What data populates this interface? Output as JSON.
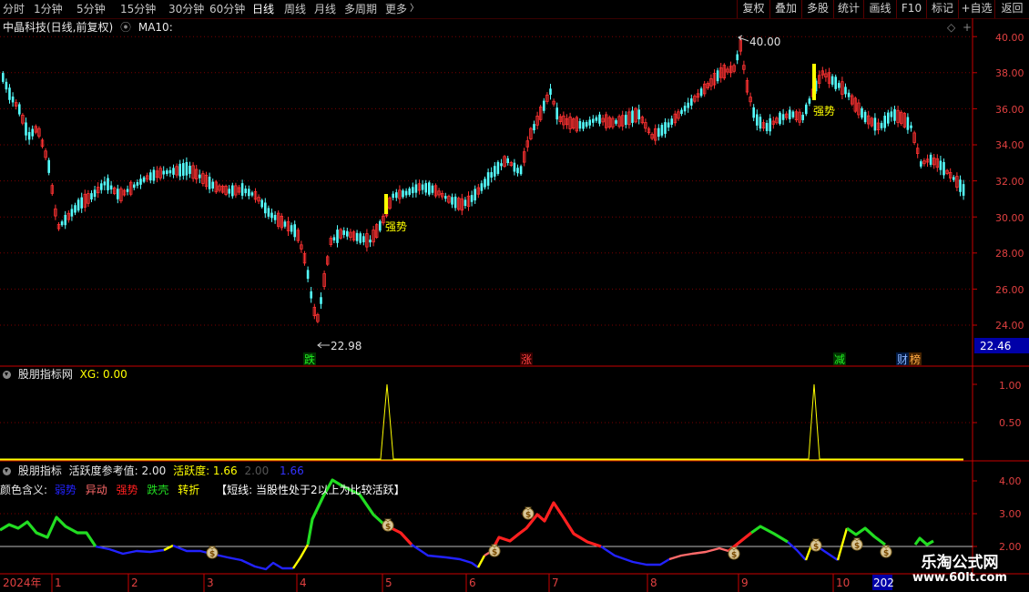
{
  "toolbar": {
    "periods": [
      "分时",
      "1分钟",
      "5分钟",
      "15分钟",
      "30分钟",
      "60分钟",
      "日线",
      "周线",
      "月线",
      "多周期",
      "更多"
    ],
    "active_period": "日线",
    "more_chevron": "〉",
    "right_buttons": [
      "复权",
      "叠加",
      "多股",
      "统计",
      "画线",
      "F10",
      "标记",
      "+自选",
      "返回"
    ]
  },
  "main": {
    "stock_title": "中晶科技(日线,前复权)",
    "ma_label": "MA10:",
    "y_ticks": [
      "40.00",
      "38.00",
      "36.00",
      "34.00",
      "32.00",
      "30.00",
      "28.00",
      "26.00",
      "24.00"
    ],
    "high_label": "40.00",
    "low_label": "22.98",
    "last_price": "22.46",
    "signal_labels": [
      "强势",
      "强势"
    ],
    "event_labels": {
      "die": "跌",
      "zhang": "涨",
      "jian": "减",
      "cai": "财",
      "bao": "榜"
    }
  },
  "panel2": {
    "title": "股朋指标网",
    "xg": "XG: 0.00",
    "y_ticks": [
      "1.00",
      "0.50"
    ]
  },
  "panel3": {
    "title": "股朋指标",
    "ref_label": "活跃度参考值: 2.00",
    "act_label": "活跃度: 1.66",
    "v1": "2.00",
    "v2": "1.66",
    "legend_title": "颜色含义:",
    "legend": [
      {
        "label": "弱势",
        "color": "#2222ff"
      },
      {
        "label": "异动",
        "color": "#ff6a6a"
      },
      {
        "label": "强势",
        "color": "#ff2020"
      },
      {
        "label": "跌壳",
        "color": "#22dd22"
      },
      {
        "label": "转折",
        "color": "#ffff00"
      }
    ],
    "note": "【短线: 当股性处于2以上为比较活跃】",
    "y_ticks": [
      "4.00",
      "3.00",
      "2.00"
    ]
  },
  "xaxis": {
    "year": "2024年",
    "months": [
      "1",
      "2",
      "3",
      "4",
      "5",
      "6",
      "7",
      "8",
      "9",
      "10"
    ],
    "year_end": "202"
  },
  "watermark": {
    "name": "乐淘公式网",
    "url": "www.60lt.com"
  },
  "colors": {
    "up": "#ff3232",
    "down": "#54fcfc",
    "grid": "#7a0000",
    "axis": "#c80000",
    "yellow": "#ffff00"
  }
}
